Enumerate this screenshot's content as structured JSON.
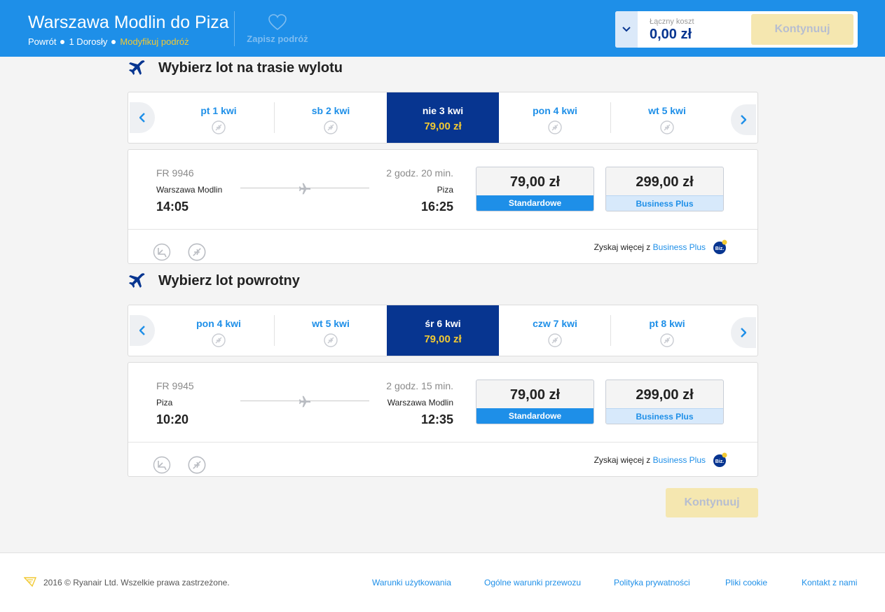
{
  "header": {
    "route_title": "Warszawa Modlin do Piza",
    "trip_type": "Powrót",
    "passengers": "1 Dorosły",
    "modify_label": "Modyfikuj podróż",
    "save_trip_label": "Zapisz podróż",
    "total_cost_label": "Łączny koszt",
    "total_cost_value": "0,00 zł",
    "continue_label": "Kontynuuj"
  },
  "outbound": {
    "heading": "Wybierz lot na trasie wylotu",
    "dates": [
      {
        "label": "pt 1 kwi"
      },
      {
        "label": "sb 2 kwi"
      },
      {
        "label": "nie 3 kwi",
        "price": "79,00 zł",
        "selected": true
      },
      {
        "label": "pon 4 kwi"
      },
      {
        "label": "wt 5 kwi"
      }
    ],
    "flight": {
      "number": "FR 9946",
      "duration": "2 godz. 20 min.",
      "from_city": "Warszawa Modlin",
      "to_city": "Piza",
      "dep_time": "14:05",
      "arr_time": "16:25",
      "fares": [
        {
          "price": "79,00 zł",
          "name": "Standardowe"
        },
        {
          "price": "299,00 zł",
          "name": "Business Plus"
        }
      ],
      "upsell_text": "Zyskaj więcej z",
      "upsell_link": "Business Plus",
      "badge": "Biz."
    }
  },
  "return": {
    "heading": "Wybierz lot powrotny",
    "dates": [
      {
        "label": "pon 4 kwi"
      },
      {
        "label": "wt 5 kwi"
      },
      {
        "label": "śr 6 kwi",
        "price": "79,00 zł",
        "selected": true
      },
      {
        "label": "czw 7 kwi"
      },
      {
        "label": "pt 8 kwi"
      }
    ],
    "flight": {
      "number": "FR 9945",
      "duration": "2 godz. 15 min.",
      "from_city": "Piza",
      "to_city": "Warszawa Modlin",
      "dep_time": "10:20",
      "arr_time": "12:35",
      "fares": [
        {
          "price": "79,00 zł",
          "name": "Standardowe"
        },
        {
          "price": "299,00 zł",
          "name": "Business Plus"
        }
      ],
      "upsell_text": "Zyskaj więcej z",
      "upsell_link": "Business Plus",
      "badge": "Biz."
    }
  },
  "continue_label": "Kontynuuj",
  "footer": {
    "copyright": "2016 © Ryanair Ltd. Wszelkie prawa zastrzeżone.",
    "links": [
      "Warunki użytkowania",
      "Ogólne warunki przewozu",
      "Polityka prywatności",
      "Pliki cookie",
      "Kontakt z nami"
    ]
  },
  "colors": {
    "brand_blue": "#073590",
    "accent_blue": "#1e8fe8",
    "accent_yellow": "#f1c933",
    "disabled_button": "#f5e7b0"
  },
  "icons": [
    "heart-icon",
    "chevron-down-icon",
    "plane-icon",
    "chevron-left-icon",
    "chevron-right-icon",
    "no-flight-icon",
    "seat-icon",
    "biz-badge-icon",
    "ryanair-logo"
  ]
}
